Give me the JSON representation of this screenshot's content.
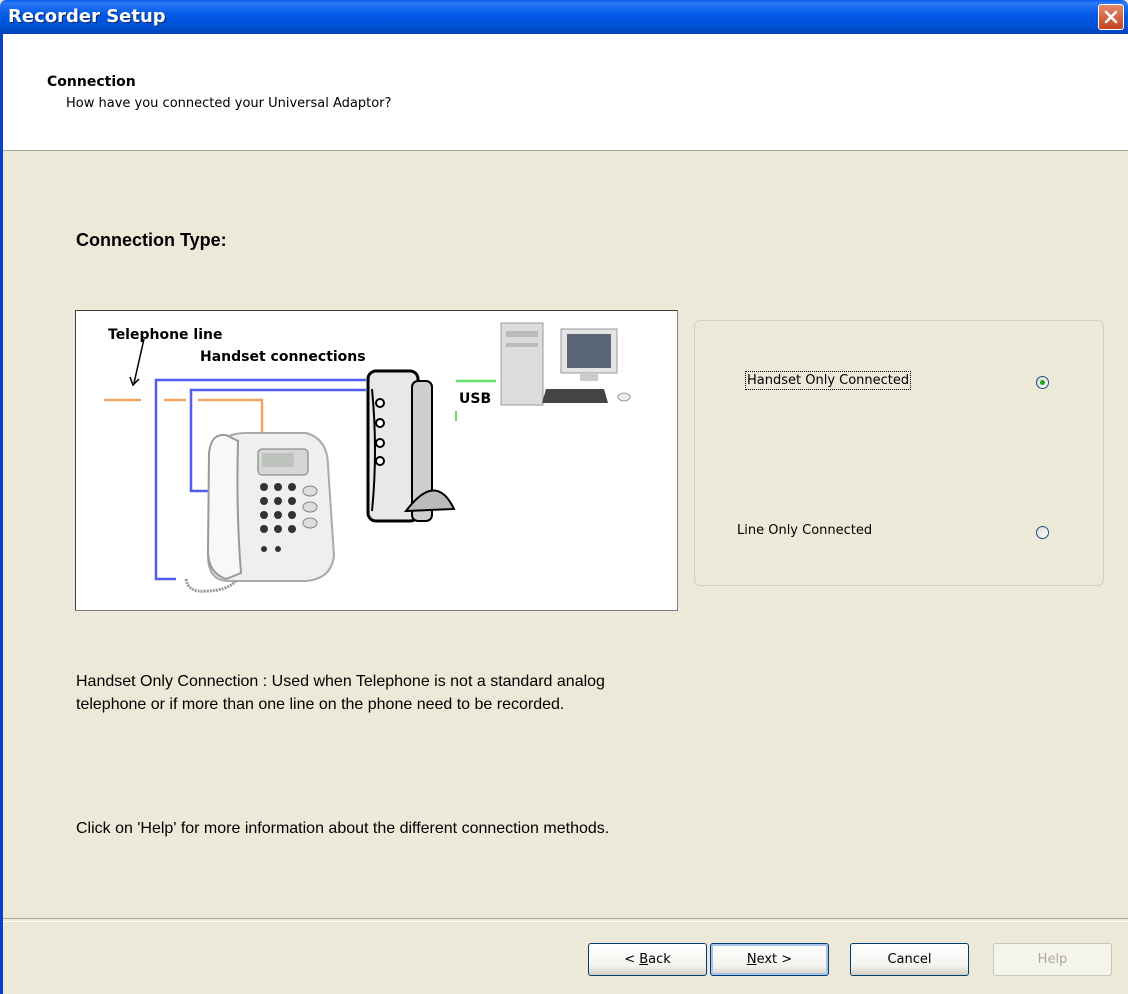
{
  "window": {
    "title": "Recorder Setup"
  },
  "header": {
    "title": "Connection",
    "subtitle": "How have you connected your Universal Adaptor?"
  },
  "main": {
    "connection_type_label": "Connection Type:",
    "diagram": {
      "telephone_line_label": "Telephone line",
      "handset_connections_label": "Handset connections",
      "usb_label": "USB"
    },
    "options": [
      {
        "label": "Handset Only Connected",
        "selected": true
      },
      {
        "label": "Line Only Connected",
        "selected": false
      }
    ],
    "description": "Handset Only Connection : Used when Telephone is not a standard analog telephone or if more than one line on the phone need to be recorded.",
    "help_note": "Click on 'Help' for more information about the different connection methods."
  },
  "footer": {
    "back_prefix": "< ",
    "back_key": "B",
    "back_rest": "ack",
    "next_key": "N",
    "next_rest": "ext >",
    "cancel_label": "Cancel",
    "help_label": "Help"
  },
  "colors": {
    "dialog_bg": "#ece9d8",
    "titlebar": "#0058e6",
    "telephone_line": "#f4a460",
    "handset_line": "#4f5ef0",
    "usb_line": "#66dd66",
    "radio_dot": "#21a121"
  },
  "icons": [
    "close-icon",
    "phone-illustration",
    "adaptor-illustration",
    "computer-illustration"
  ]
}
